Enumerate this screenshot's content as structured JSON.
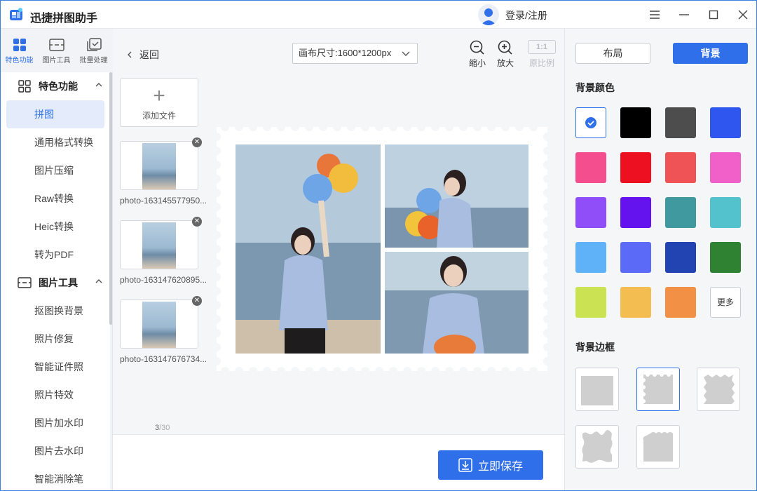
{
  "app": {
    "title": "迅捷拼图助手",
    "login": "登录/注册"
  },
  "left": {
    "tabs": [
      {
        "label": "特色功能",
        "icon": "grid-icon"
      },
      {
        "label": "图片工具",
        "icon": "image-tool-icon"
      },
      {
        "label": "批量处理",
        "icon": "batch-icon"
      }
    ],
    "section1": {
      "label": "特色功能",
      "items": [
        "拼图",
        "通用格式转换",
        "图片压缩",
        "Raw转换",
        "Heic转换",
        "转为PDF"
      ]
    },
    "section2": {
      "label": "图片工具",
      "items": [
        "抠图换背景",
        "照片修复",
        "智能证件照",
        "照片特效",
        "图片加水印",
        "图片去水印",
        "智能消除笔"
      ]
    }
  },
  "center": {
    "back": "返回",
    "canvas_size": "画布尺寸:1600*1200px",
    "tools": [
      {
        "label": "缩小"
      },
      {
        "label": "放大"
      },
      {
        "label": "原比例",
        "badge": "1:1"
      }
    ],
    "add_file": "添加文件",
    "files": [
      "photo-163145577950...",
      "photo-163147620895...",
      "photo-163147676734..."
    ],
    "count": {
      "current": "3",
      "max": "/30"
    },
    "save": "立即保存"
  },
  "right": {
    "tabs": [
      "布局",
      "背景"
    ],
    "bg_color_title": "背景颜色",
    "colors": [
      "#ffffff",
      "#000000",
      "#4d4d4d",
      "#3056f0",
      "#f54e8f",
      "#ec1020",
      "#f05356",
      "#f060c8",
      "#8f4ef8",
      "#6412ee",
      "#3f999e",
      "#53c2cc",
      "#5fb2f8",
      "#5c6af8",
      "#2244b2",
      "#2e8232",
      "#cbe252",
      "#f4bd52",
      "#f29146"
    ],
    "more": "更多",
    "border_title": "背景边框"
  }
}
